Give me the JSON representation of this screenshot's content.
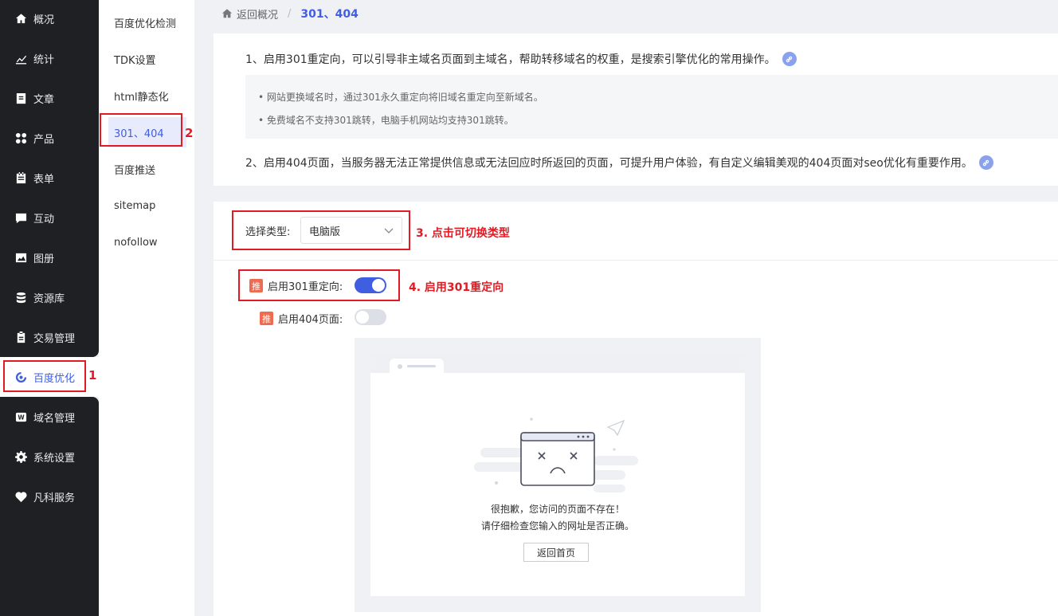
{
  "nav": {
    "items": [
      {
        "label": "概况",
        "icon": "home-icon"
      },
      {
        "label": "统计",
        "icon": "chart-icon"
      },
      {
        "label": "文章",
        "icon": "article-icon"
      },
      {
        "label": "产品",
        "icon": "grid-icon"
      },
      {
        "label": "表单",
        "icon": "form-icon"
      },
      {
        "label": "互动",
        "icon": "chat-icon"
      },
      {
        "label": "图册",
        "icon": "gallery-icon"
      },
      {
        "label": "资源库",
        "icon": "database-icon"
      },
      {
        "label": "交易管理",
        "icon": "clipboard-icon"
      },
      {
        "label": "百度优化",
        "icon": "baidu-icon"
      },
      {
        "label": "域名管理",
        "icon": "domain-icon"
      },
      {
        "label": "系统设置",
        "icon": "gear-icon"
      },
      {
        "label": "凡科服务",
        "icon": "heart-icon"
      }
    ],
    "active_index": 9
  },
  "subnav": {
    "items": [
      "百度优化检测",
      "TDK设置",
      "html静态化",
      "301、404",
      "百度推送",
      "sitemap",
      "nofollow"
    ],
    "active_index": 3
  },
  "breadcrumb": {
    "back": "返回概况",
    "separator": "/",
    "current": "301、404"
  },
  "info": {
    "line1": "1、启用301重定向，可以引导非主域名页面到主域名，帮助转移域名的权重，是搜索引擎优化的常用操作。",
    "notes": [
      "• 网站更换域名时，通过301永久重定向将旧域名重定向至新域名。",
      "• 免费域名不支持301跳转，电脑手机网站均支持301跳转。"
    ],
    "line2": "2、启用404页面，当服务器无法正常提供信息或无法回应时所返回的页面，可提升用户体验，有自定义编辑美观的404页面对seo优化有重要作用。"
  },
  "settings": {
    "type_label": "选择类型:",
    "type_value": "电脑版",
    "tag": "推",
    "redirect_label": "启用301重定向:",
    "redirect_on": true,
    "page404_label": "启用404页面:",
    "page404_on": false
  },
  "preview": {
    "msg1": "很抱歉，您访问的页面不存在！",
    "msg2": "请仔细检查您输入的网址是否正确。",
    "home_button": "返回首页"
  },
  "annotations": {
    "n1": "1",
    "n2": "2",
    "n3": "3. 点击可切换类型",
    "n4": "4. 启用301重定向"
  },
  "colors": {
    "accent": "#3f5ee0",
    "nav_bg": "#1f2023",
    "annotation": "#e21a23",
    "tag": "#ee6a50"
  }
}
